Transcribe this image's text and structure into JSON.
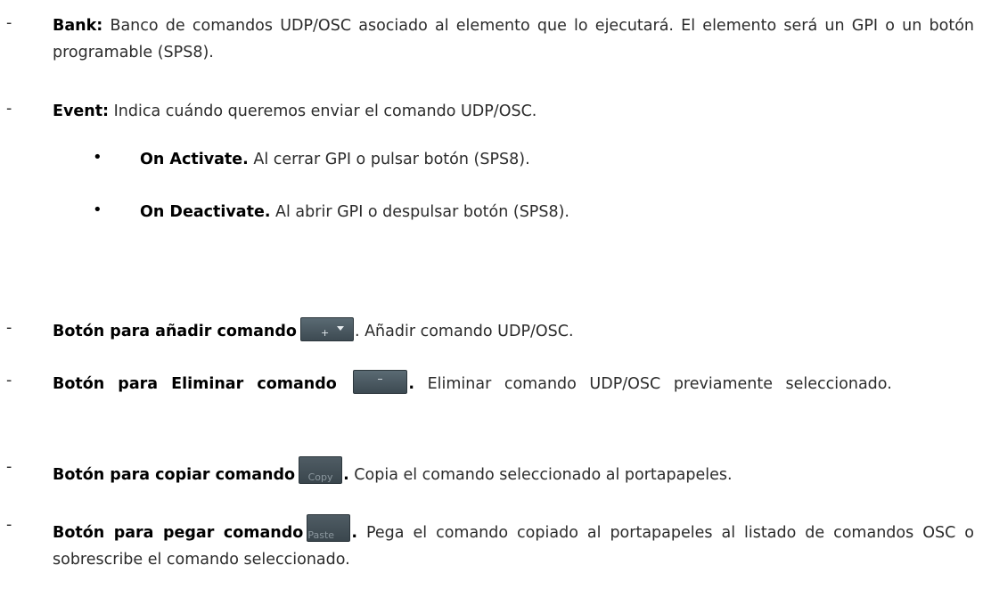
{
  "bank": {
    "dash": "-",
    "term": "Bank:",
    "desc": " Banco de comandos UDP/OSC asociado al elemento que lo ejecutará. El elemento será un GPI o un botón programable (SPS8)."
  },
  "event": {
    "dash": "-",
    "term": "Event:",
    "desc": " Indica cuándo queremos enviar el comando UDP/OSC.",
    "options": [
      {
        "bullet": "•",
        "term": "On Activate.",
        "desc": " Al cerrar GPI o pulsar botón (SPS8)."
      },
      {
        "bullet": "•",
        "term": "On Deactivate.",
        "desc": " Al abrir GPI o despulsar botón (SPS8)."
      }
    ]
  },
  "add_command": {
    "dash": "-",
    "term": "Botón para añadir comando",
    "button_icon": "plus-dropdown-icon",
    "desc": ". Añadir comando UDP/OSC."
  },
  "delete_command": {
    "dash": "-",
    "term": "Botón para Eliminar comando",
    "button_icon": "minus-icon",
    "term_end": ".",
    "desc": " Eliminar comando UDP/OSC previamente seleccionado."
  },
  "copy_command": {
    "dash": "-",
    "term": "Botón para copiar comando",
    "button_label": "Copy",
    "term_end": ".",
    "desc": " Copia el comando seleccionado al portapapeles."
  },
  "paste_command": {
    "dash": "-",
    "term": "Botón para pegar comando",
    "button_label": "Paste",
    "term_end": ".",
    "desc": " Pega el comando copiado al portapapeles al listado de comandos OSC o sobrescribe el comando seleccionado."
  }
}
